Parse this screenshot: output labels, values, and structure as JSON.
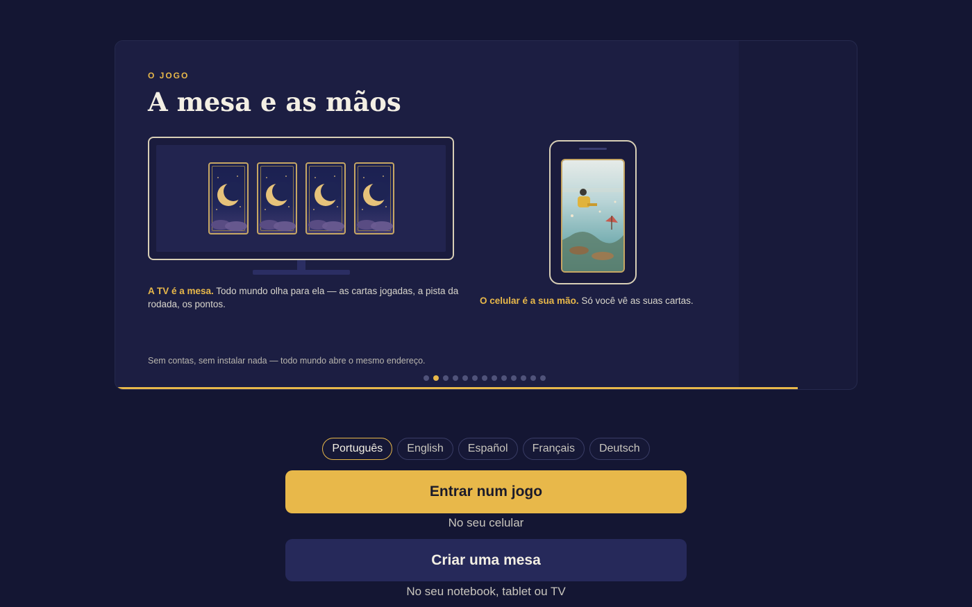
{
  "slide": {
    "eyebrow": "O JOGO",
    "title": "A mesa e as mãos",
    "tv_caption_bold": "A TV é a mesa.",
    "tv_caption_rest": " Todo mundo olha para ela — as cartas jogadas, a pista da rodada, os pontos.",
    "phone_caption_bold": "O celular é a sua mão.",
    "phone_caption_rest": " Só você vê as suas cartas.",
    "footnote": "Sem contas, sem instalar nada — todo mundo abre o mesmo endereço.",
    "card_icon": "crescent-moon-icon",
    "card_count": 4
  },
  "carousel": {
    "total_slides": 13,
    "active_index": 1,
    "progress": 0.92
  },
  "languages": [
    {
      "label": "Português",
      "active": true
    },
    {
      "label": "English",
      "active": false
    },
    {
      "label": "Español",
      "active": false
    },
    {
      "label": "Français",
      "active": false
    },
    {
      "label": "Deutsch",
      "active": false
    }
  ],
  "actions": {
    "join_label": "Entrar num jogo",
    "join_sub": "No seu celular",
    "create_label": "Criar uma mesa",
    "create_sub": "No seu notebook, tablet ou TV"
  },
  "colors": {
    "accent": "#e8b84a",
    "background": "#141633",
    "panel": "#1c1e42",
    "secondary_button": "#26295a"
  }
}
